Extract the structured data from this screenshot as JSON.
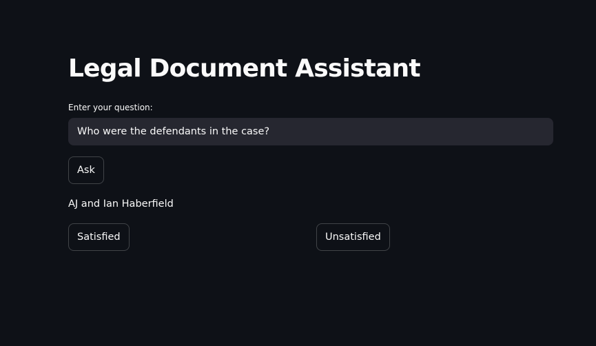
{
  "app": {
    "title": "Legal Document Assistant"
  },
  "question": {
    "label": "Enter your question:",
    "value": "Who were the defendants in the case?"
  },
  "ask_button": {
    "label": "Ask"
  },
  "answer": {
    "text": "AJ and Ian Haberfield"
  },
  "feedback": {
    "satisfied_label": "Satisfied",
    "unsatisfied_label": "Unsatisfied"
  },
  "colors": {
    "background": "#0e1117",
    "input_background": "#262730",
    "text": "#fafafa",
    "button_border": "#4a4d55"
  }
}
